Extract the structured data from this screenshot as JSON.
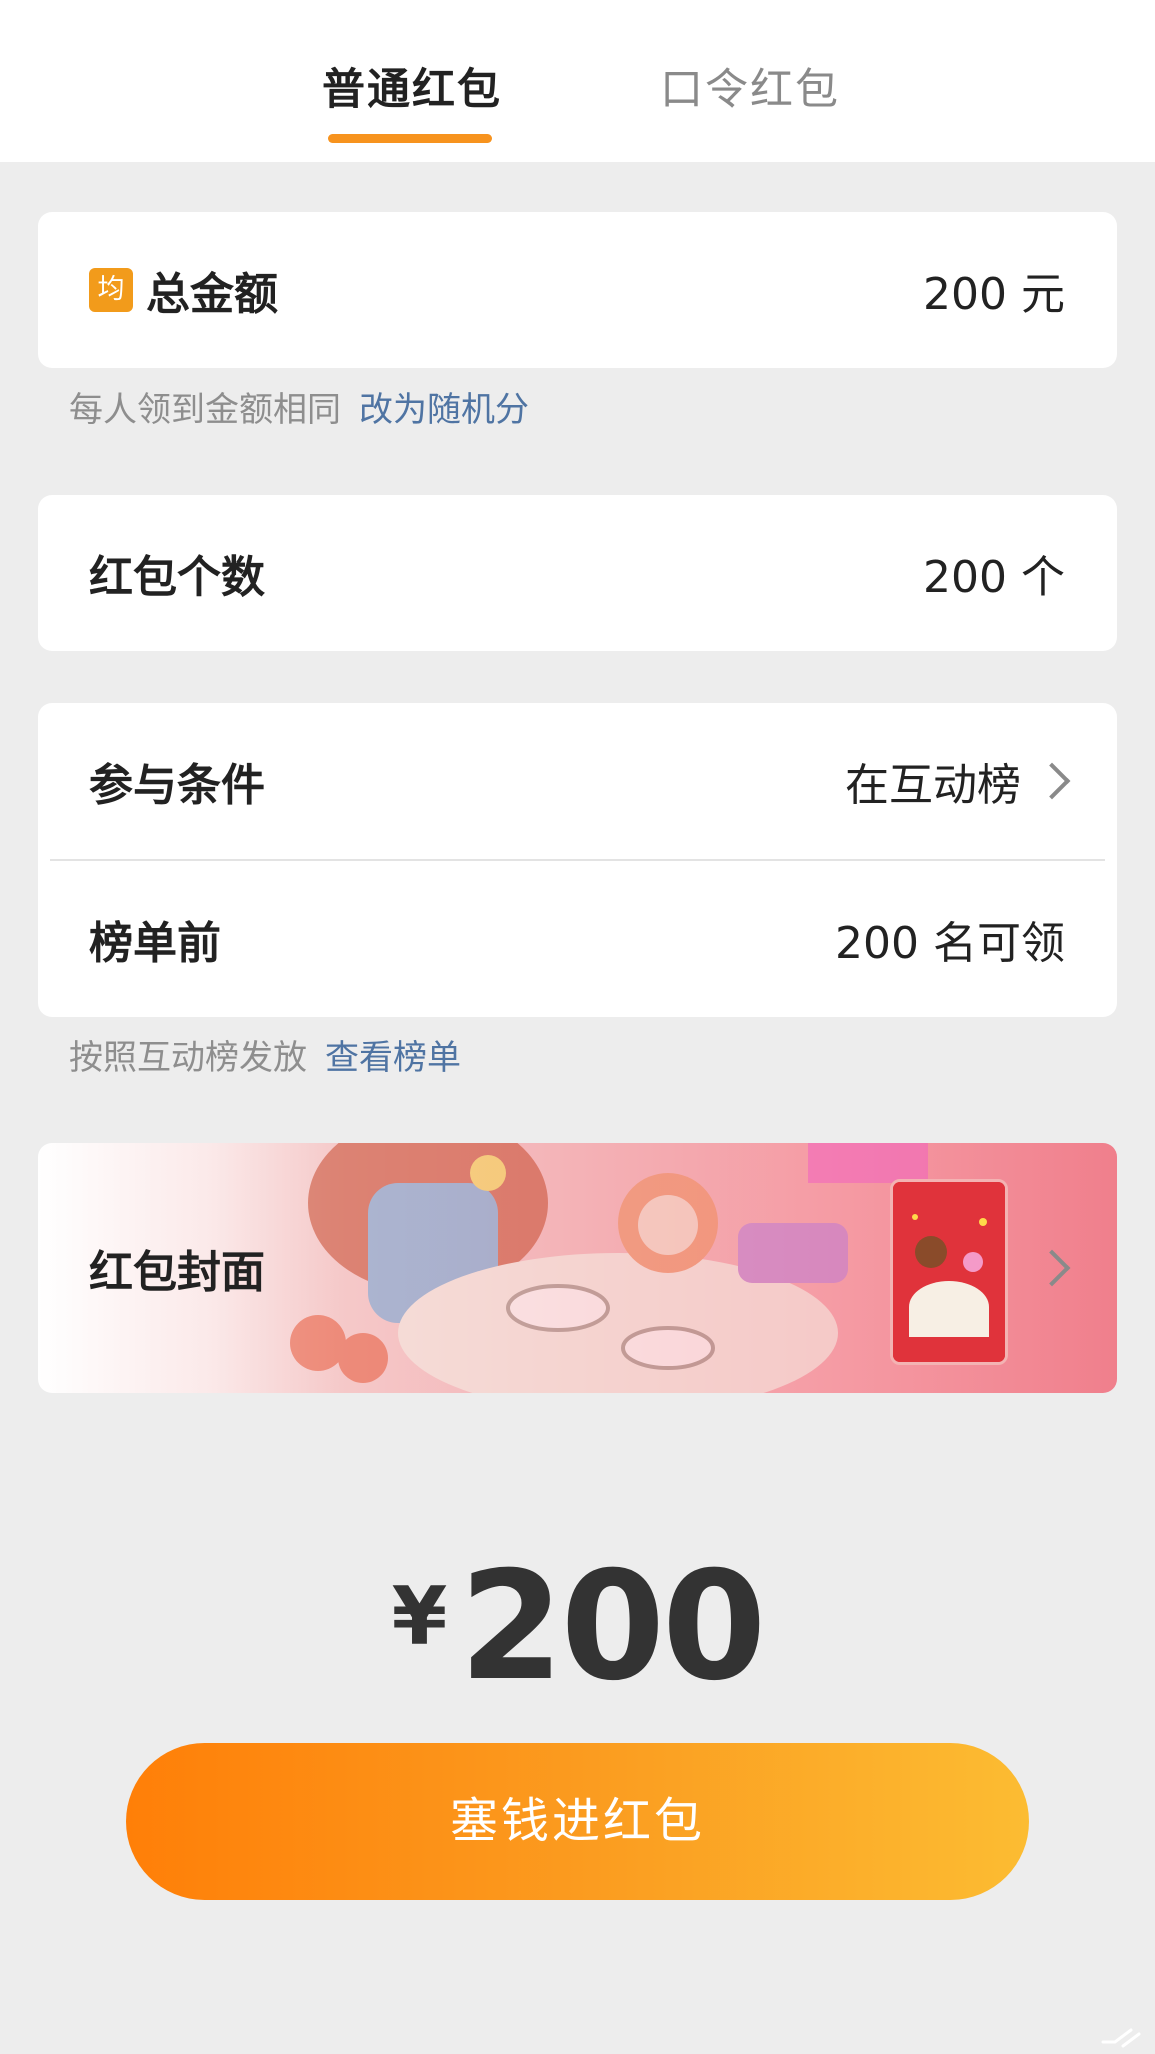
{
  "tabs": [
    {
      "label": "普通红包",
      "active": true
    },
    {
      "label": "口令红包",
      "active": false
    }
  ],
  "total_amount": {
    "badge": "均",
    "label": "总金额",
    "value": "200 元"
  },
  "total_hint": {
    "text": "每人领到金额相同",
    "link": "改为随机分"
  },
  "count": {
    "label": "红包个数",
    "value": "200 个"
  },
  "condition": {
    "label": "参与条件",
    "value": "在互动榜"
  },
  "rank": {
    "label": "榜单前",
    "value": "200 名可领"
  },
  "rank_hint": {
    "text": "按照互动榜发放",
    "link": "查看榜单"
  },
  "cover": {
    "label": "红包封面"
  },
  "amount": {
    "currency": "¥",
    "value": "200"
  },
  "submit_label": "塞钱进红包",
  "colors": {
    "accent": "#f7931e",
    "link": "#4f74a3",
    "background": "#ededed",
    "button_start": "#ff7f08",
    "button_end": "#fcbc32"
  }
}
